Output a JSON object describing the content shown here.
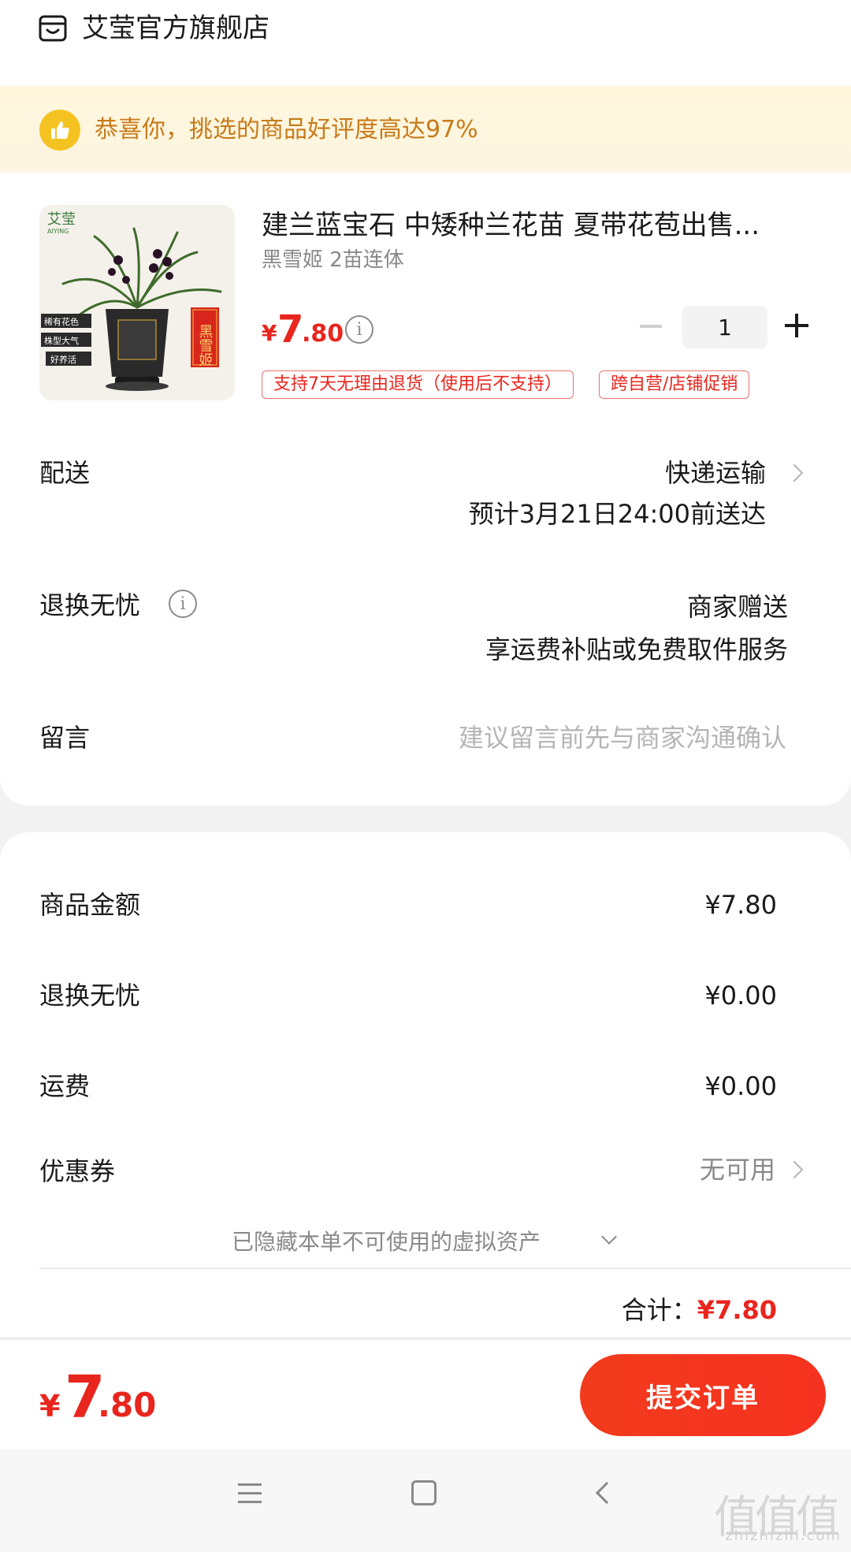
{
  "shop": {
    "name": "艾莹官方旗舰店"
  },
  "banner": {
    "text": "恭喜你，挑选的商品好评度高达97%"
  },
  "product": {
    "title": "建兰蓝宝石 中矮种兰花苗 夏带花苞出售...",
    "variant": "黑雪姬 2苗连体",
    "price_symbol": "¥",
    "price_int": "7",
    "price_dec": ".80",
    "quantity": "1",
    "tags": [
      "支持7天无理由退货（使用后不支持）",
      "跨自营/店铺促销"
    ],
    "image_text": {
      "brand": "艾莹",
      "brand_en": "AIYING",
      "badges": [
        "稀有花色",
        "株型大气",
        "好养活"
      ],
      "name_label": "黑雪姬"
    }
  },
  "delivery": {
    "label": "配送",
    "method": "快递运输",
    "eta": "预计3月21日24:00前送达"
  },
  "returns": {
    "label": "退换无忧",
    "value1": "商家赠送",
    "value2": "享运费补贴或免费取件服务"
  },
  "message": {
    "label": "留言",
    "placeholder": "建议留言前先与商家沟通确认"
  },
  "summary": {
    "rows": [
      {
        "label": "商品金额",
        "value": "¥7.80"
      },
      {
        "label": "退换无忧",
        "value": "¥0.00"
      },
      {
        "label": "运费",
        "value": "¥0.00"
      }
    ],
    "coupon_label": "优惠券",
    "coupon_value": "无可用",
    "hidden_assets": "已隐藏本单不可使用的虚拟资产",
    "total_label": "合计：",
    "total_value": "¥7.80"
  },
  "bottom": {
    "price_symbol": "¥",
    "price_int": "7",
    "price_dec": ".80",
    "submit_label": "提交订单"
  },
  "watermark": {
    "main": "值值值",
    "sub": "zhizhizhi.com"
  },
  "colors": {
    "accent": "#e8261e",
    "banner_text": "#c77a1a",
    "banner_bg": "#fdf5e1",
    "button": "#f23b1d"
  }
}
